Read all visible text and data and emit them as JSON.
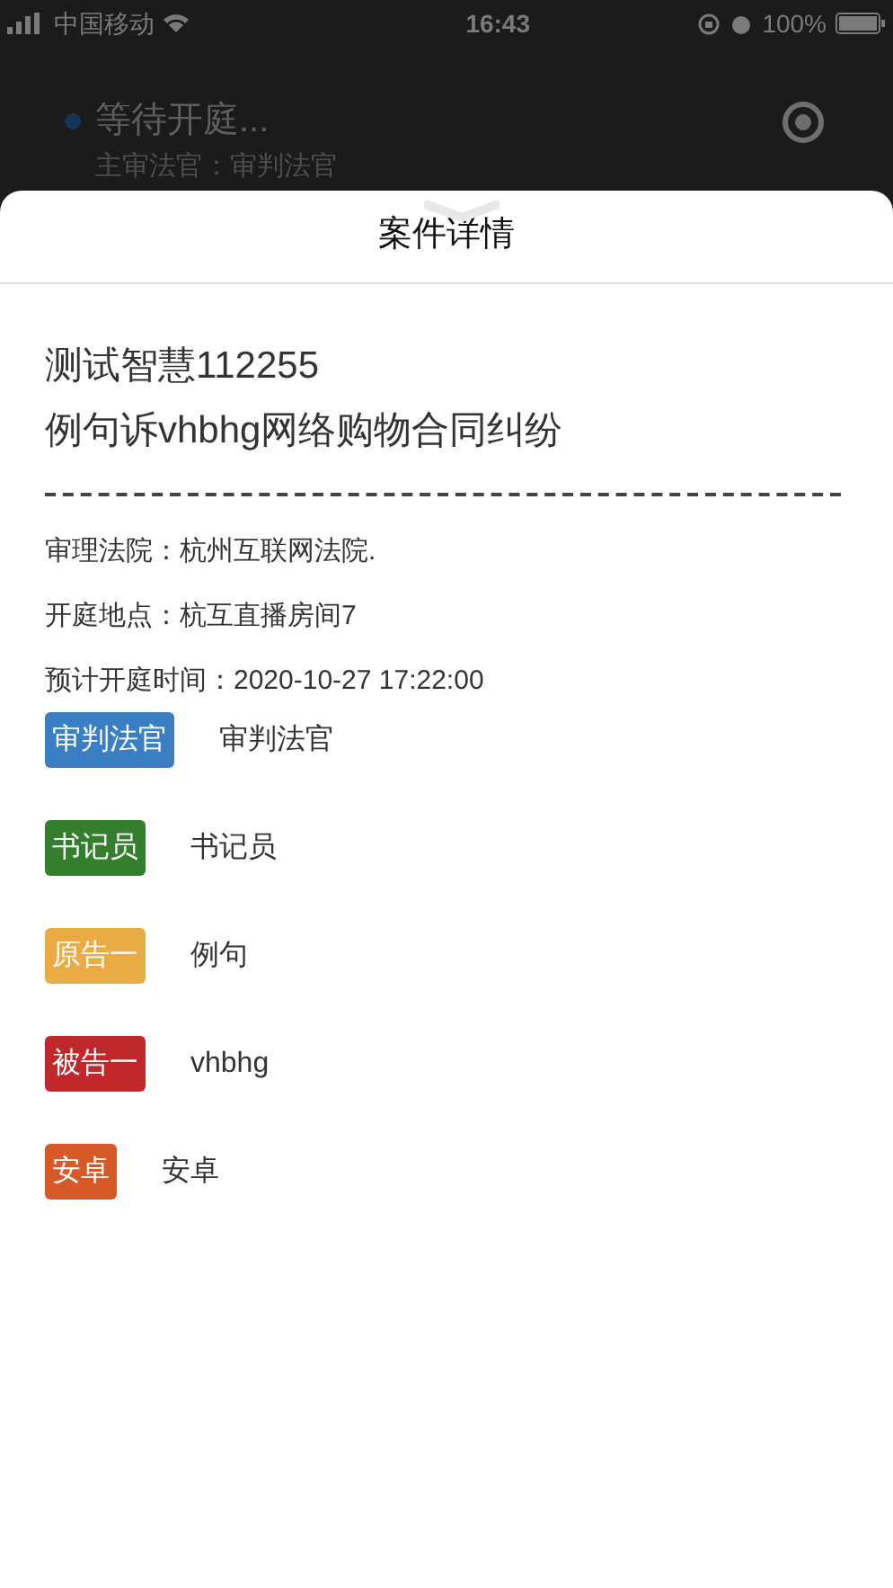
{
  "status_bar": {
    "carrier": "中国移动",
    "time": "16:43",
    "battery": "100%"
  },
  "background": {
    "status": "等待开庭...",
    "judge_line": "主审法官：审判法官"
  },
  "sheet": {
    "title": "案件详情"
  },
  "case": {
    "name": "测试智慧112255",
    "title": "例句诉vhbhg网络购物合同纠纷"
  },
  "details": [
    "审理法院：杭州互联网法院.",
    "开庭地点：杭互直播房间7",
    "预计开庭时间：2020-10-27 17:22:00"
  ],
  "participants": [
    {
      "role": "审判法官",
      "name": "审判法官",
      "color": "#3a7ec4"
    },
    {
      "role": "书记员",
      "name": "书记员",
      "color": "#337f2e"
    },
    {
      "role": "原告一",
      "name": "例句",
      "color": "#ebab44"
    },
    {
      "role": "被告一",
      "name": "vhbhg",
      "color": "#c0282b"
    },
    {
      "role": "安卓",
      "name": "安卓",
      "color": "#d65a27"
    }
  ]
}
